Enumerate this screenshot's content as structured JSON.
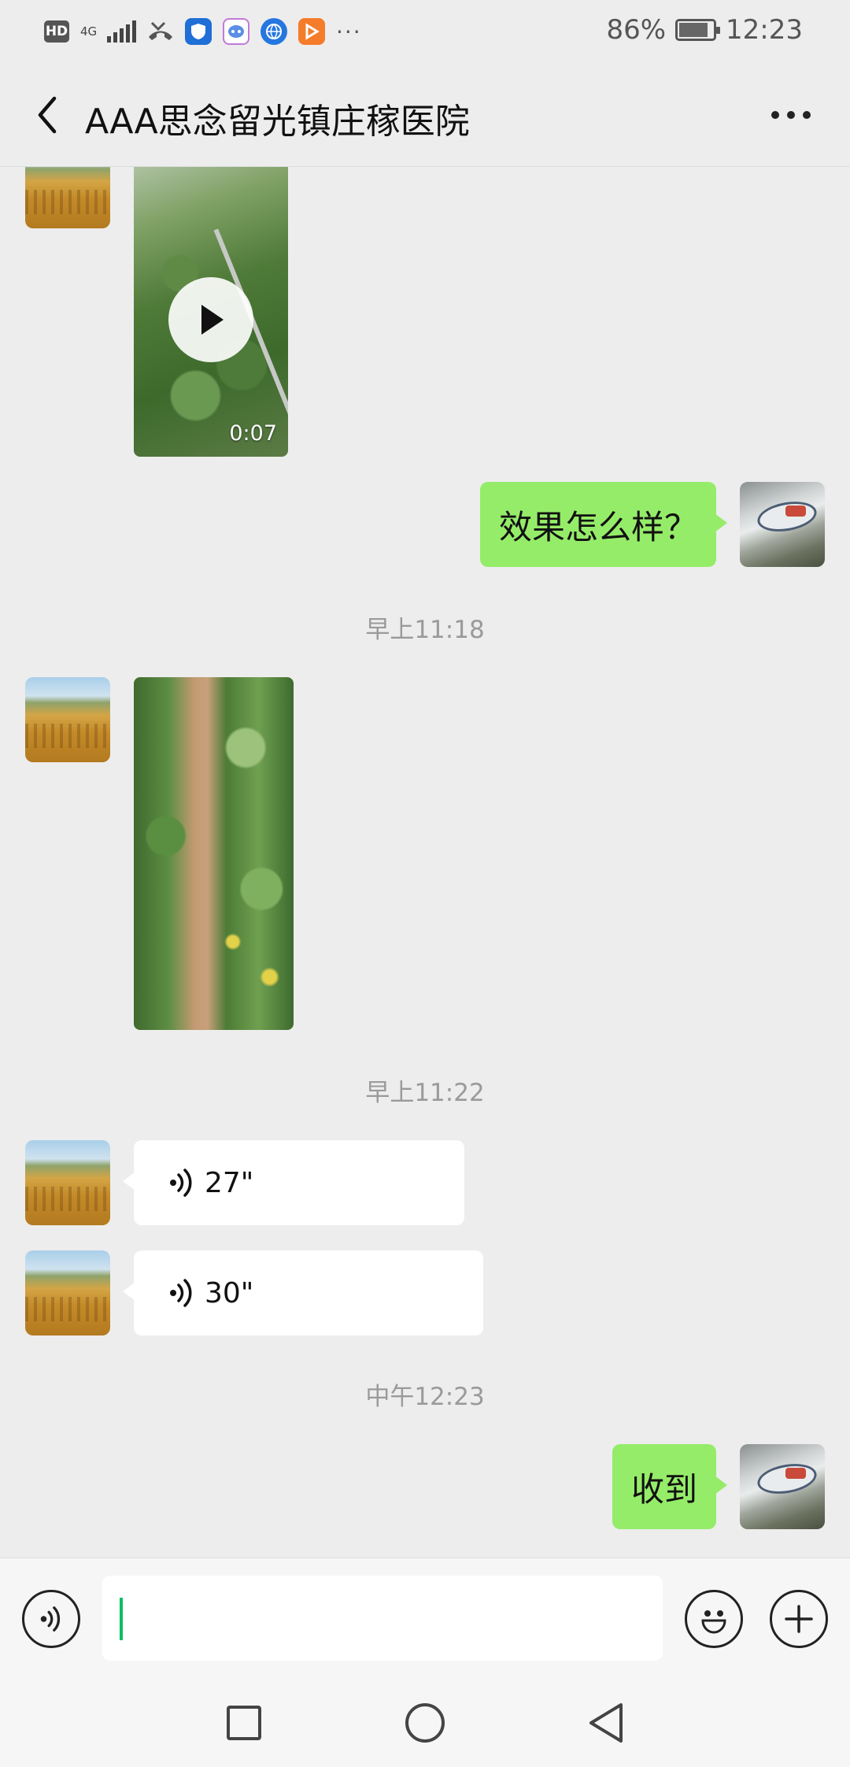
{
  "status_bar": {
    "battery_percent": "86%",
    "battery_level": 0.86,
    "time": "12:23",
    "network": "4G",
    "hd_label": "HD",
    "icons": [
      "hd-icon",
      "signal-icon",
      "missed-call-icon",
      "shield-app-icon",
      "chat-app-icon",
      "browser-app-icon",
      "video-app-icon"
    ],
    "more": "···"
  },
  "header": {
    "title": "AAA思念留光镇庄稼医院"
  },
  "messages": [
    {
      "kind": "video",
      "from": "other",
      "duration": "0:07"
    },
    {
      "kind": "text",
      "from": "me",
      "text": "效果怎么样？"
    },
    {
      "kind": "time",
      "text": "早上11:18"
    },
    {
      "kind": "image",
      "from": "other"
    },
    {
      "kind": "time",
      "text": "早上11:22"
    },
    {
      "kind": "voice",
      "from": "other",
      "duration": "27\""
    },
    {
      "kind": "voice",
      "from": "other",
      "duration": "30\""
    },
    {
      "kind": "time",
      "text": "中午12:23"
    },
    {
      "kind": "text",
      "from": "me",
      "text": "收到"
    }
  ],
  "colors": {
    "background": "#ededed",
    "my_bubble": "#95ec69",
    "other_bubble": "#ffffff",
    "caret": "#07c160",
    "timestamp": "#9a9a9a"
  }
}
